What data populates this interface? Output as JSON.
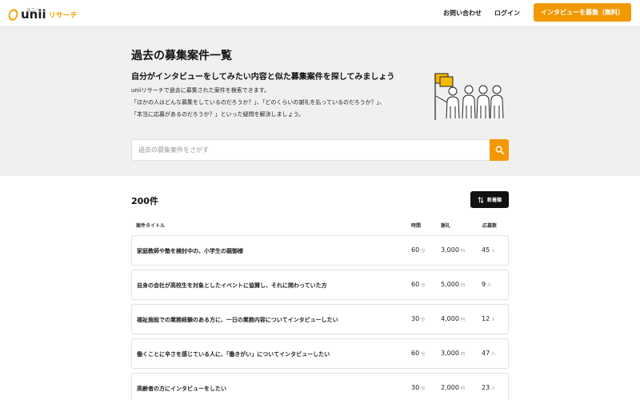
{
  "header": {
    "logo_text": "unii",
    "logo_ruby": "ユニー",
    "logo_sub": "リサーチ",
    "contact_label": "お問い合わせ",
    "login_label": "ログイン",
    "cta_label": "インタビューを募集（無料）"
  },
  "hero": {
    "title": "過去の募集案件一覧",
    "lead": "自分がインタビューをしてみたい内容と似た募集案件を探してみましょう",
    "desc": [
      "uniiリサーチで過去に募集された案件を検索できます。",
      "「ほかの人はどんな募集をしているのだろうか？」、「どのくらいの謝礼を払っているのだろうか？」、",
      "「本当に応募があるのだろうか？」といった疑問を解決しましょう。"
    ],
    "search_placeholder": "過去の募集案件をさがす"
  },
  "results": {
    "count": "200件",
    "sort_label": "新着順",
    "columns": {
      "title": "案件タイトル",
      "time": "時間",
      "reward": "謝礼",
      "applicants": "応募数"
    },
    "rows": [
      {
        "title": "家庭教師や塾を検討中の、小学生の親御様",
        "time": "60",
        "time_unit": "分",
        "reward": "3,000",
        "reward_unit": "円",
        "applicants": "45",
        "applicants_unit": "人"
      },
      {
        "title": "自身の会社が高校生を対象としたイベントに協賛し、それに関わっていた方",
        "time": "60",
        "time_unit": "分",
        "reward": "5,000",
        "reward_unit": "円",
        "applicants": "9",
        "applicants_unit": "人"
      },
      {
        "title": "福祉施設での業務経験のある方に、一日の業務内容についてインタビューしたい",
        "time": "30",
        "time_unit": "分",
        "reward": "4,000",
        "reward_unit": "円",
        "applicants": "12",
        "applicants_unit": "人"
      },
      {
        "title": "働くことに辛さを感じている人に、「働きがい」についてインタビューしたい",
        "time": "60",
        "time_unit": "分",
        "reward": "3,000",
        "reward_unit": "円",
        "applicants": "47",
        "applicants_unit": "人"
      },
      {
        "title": "高齢者の方にインタビューをしたい",
        "time": "30",
        "time_unit": "分",
        "reward": "2,000",
        "reward_unit": "円",
        "applicants": "23",
        "applicants_unit": "人"
      }
    ]
  },
  "colors": {
    "accent": "#f39800",
    "hero_bg": "#f0f0f0",
    "dark": "#111111"
  }
}
